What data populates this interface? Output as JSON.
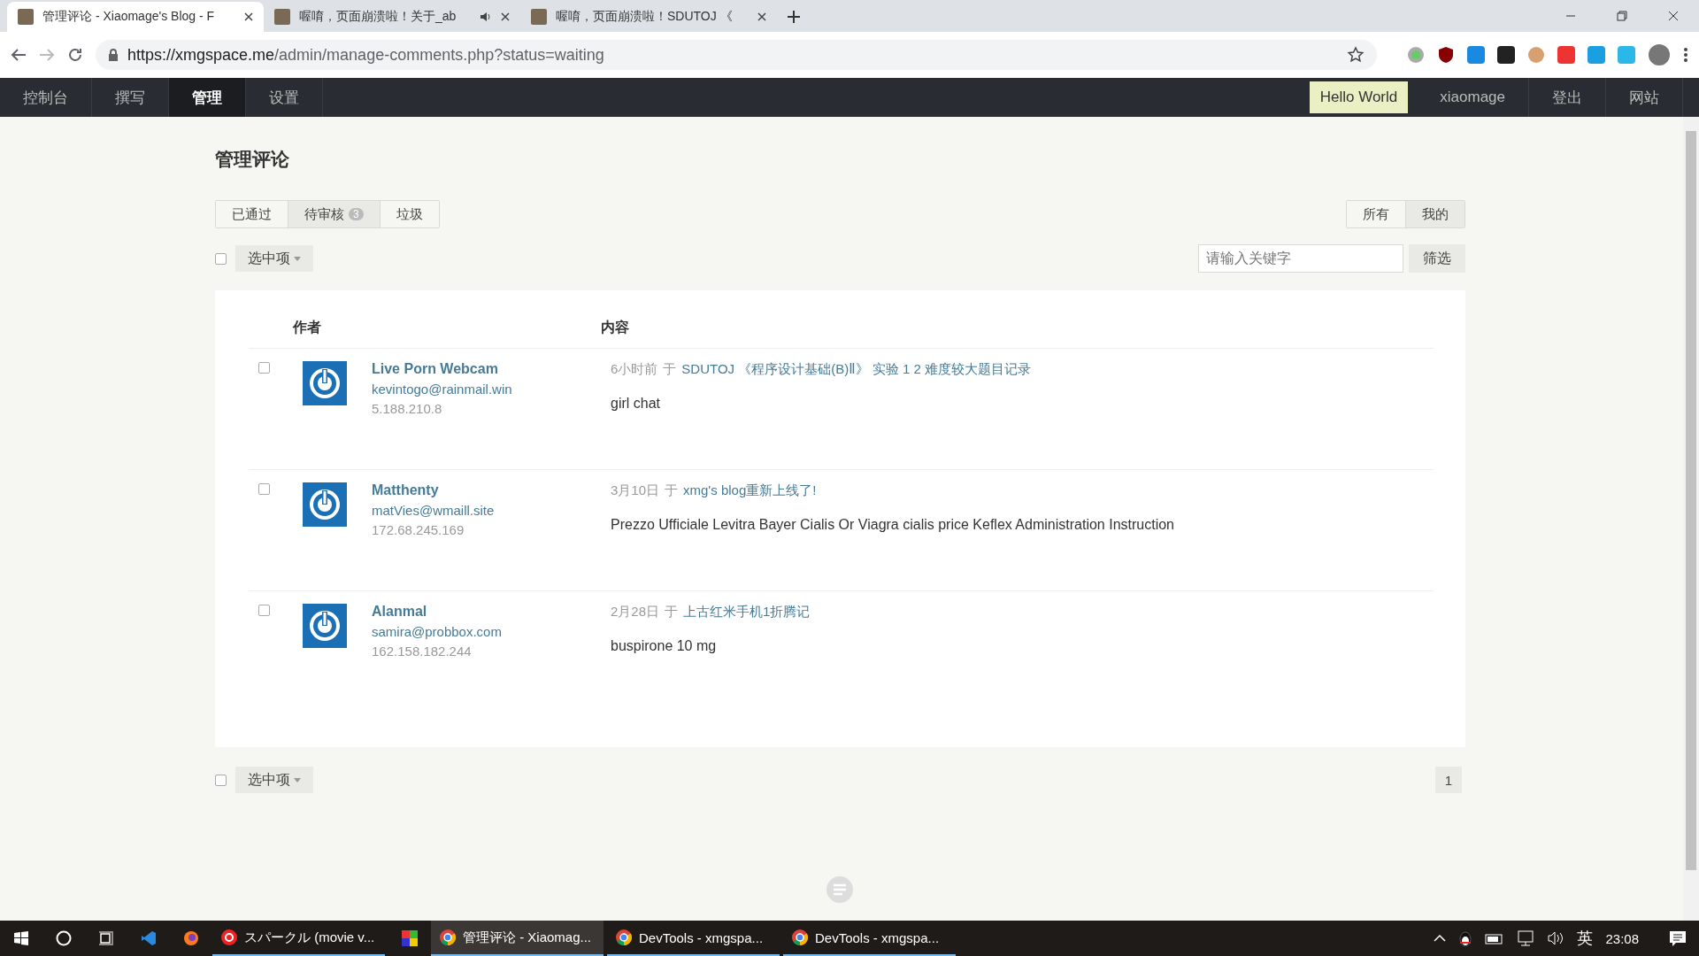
{
  "browser": {
    "tabs": [
      {
        "title": "管理评论 - Xiaomage's Blog - F",
        "selected": true,
        "audio": false
      },
      {
        "title": "喔唷，页面崩溃啦！关于_ab",
        "selected": false,
        "audio": true
      },
      {
        "title": "喔唷，页面崩溃啦！SDUTOJ 《",
        "selected": false,
        "audio": false
      }
    ],
    "url_host": "https://xmgspace.me",
    "url_path": "/admin/manage-comments.php?status=waiting"
  },
  "nav": {
    "items": [
      {
        "label": "控制台",
        "selected": false
      },
      {
        "label": "撰写",
        "selected": false
      },
      {
        "label": "管理",
        "selected": true
      },
      {
        "label": "设置",
        "selected": false
      }
    ],
    "right": [
      {
        "label": "Hello World",
        "kind": "highlight"
      },
      {
        "label": "xiaomage",
        "kind": "link"
      },
      {
        "label": "登出",
        "kind": "link"
      },
      {
        "label": "网站",
        "kind": "link"
      }
    ]
  },
  "page_title": "管理评论",
  "status_tabs": [
    {
      "label": "已通过",
      "selected": false
    },
    {
      "label": "待审核",
      "badge": "3",
      "selected": true
    },
    {
      "label": "垃圾",
      "selected": false
    }
  ],
  "scope_tabs": [
    {
      "label": "所有",
      "selected": false
    },
    {
      "label": "我的",
      "selected": true
    }
  ],
  "select_all": {
    "checked": false
  },
  "bulk_action": "选中项",
  "search": {
    "placeholder": "请输入关键字",
    "button": "筛选"
  },
  "table": {
    "columns": [
      "作者",
      "内容"
    ],
    "rows": [
      {
        "checked": false,
        "author": "Live Porn Webcam",
        "email": "kevintogo@rainmail.win",
        "ip": "5.188.210.8",
        "time": "6小时前",
        "sep": "于",
        "post": "SDUTOJ 《程序设计基础(B)Ⅱ》 实验 1 2 难度较大题目记录",
        "content": "girl chat"
      },
      {
        "checked": false,
        "author": "Matthenty",
        "email": "matVies@wmaill.site",
        "ip": "172.68.245.169",
        "time": "3月10日",
        "sep": "于",
        "post": "xmg's blog重新上线了!",
        "content": "Prezzo Ufficiale Levitra Bayer Cialis Or Viagra cialis price Keflex Administration Instruction"
      },
      {
        "checked": false,
        "author": "Alanmal",
        "email": "samira@probbox.com",
        "ip": "162.158.182.244",
        "time": "2月28日",
        "sep": "于",
        "post": "上古红米手机1折腾记",
        "content": "buspirone 10 mg"
      }
    ]
  },
  "bottom_select_all": {
    "checked": false
  },
  "bottom_bulk_action": "选中项",
  "pagination": [
    {
      "label": "1",
      "selected": true
    }
  ],
  "taskbar": {
    "apps": [
      {
        "label": "スパークル (movie v...",
        "kind": "music",
        "selected": false
      },
      {
        "label": "管理评论 - Xiaomag...",
        "kind": "chrome",
        "selected": true
      },
      {
        "label": "DevTools - xmgspa...",
        "kind": "chrome",
        "selected": false
      },
      {
        "label": "DevTools - xmgspa...",
        "kind": "chrome",
        "selected": false
      }
    ],
    "ime": "英",
    "clock": "23:08"
  }
}
